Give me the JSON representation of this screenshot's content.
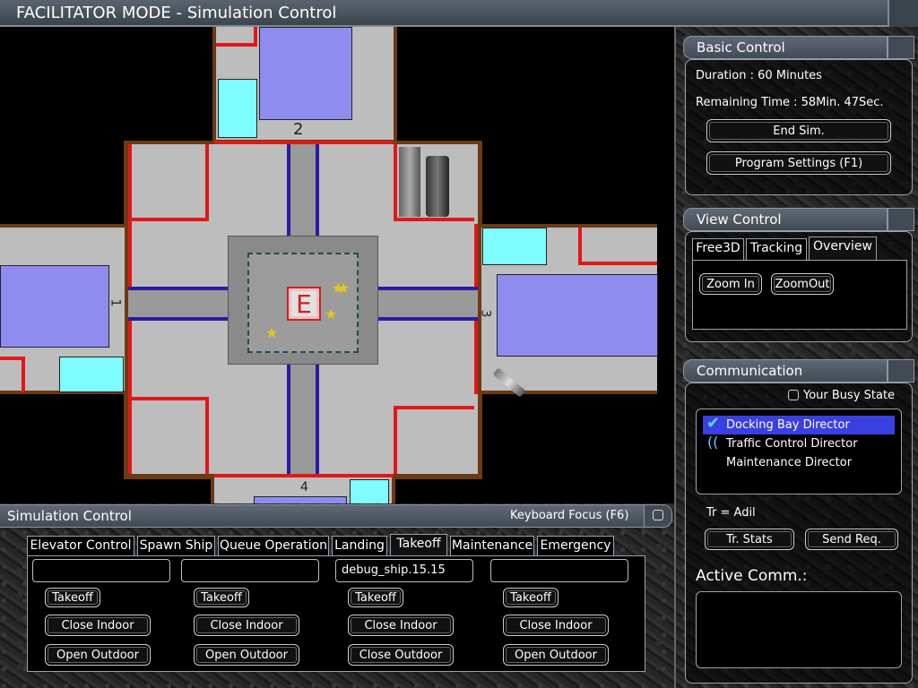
{
  "window": {
    "title": "FACILITATOR MODE - Simulation Control"
  },
  "map": {
    "elevator_label": "E",
    "bay_labels": [
      "2",
      "1",
      "3",
      "4"
    ]
  },
  "basic_control": {
    "title": "Basic Control",
    "duration": "Duration : 60 Minutes",
    "remaining": "Remaining Time : 58Min. 47Sec.",
    "end_sim": "End Sim.",
    "program_settings": "Program Settings (F1)"
  },
  "view_control": {
    "title": "View Control",
    "tabs": [
      "Free3D",
      "Tracking",
      "Overview"
    ],
    "zoom_in": "Zoom In",
    "zoom_out": "ZoomOut"
  },
  "communication": {
    "title": "Communication",
    "busy_state": "Your Busy State",
    "directors": [
      "Docking Bay Director",
      "Traffic Control Director",
      "Maintenance Director"
    ],
    "tr_line": "Tr = Adil",
    "tr_stats": "Tr. Stats",
    "send_req": "Send Req.",
    "active_comm": "Active Comm.:"
  },
  "sim_control": {
    "title": "Simulation Control",
    "keyboard_focus": "Keyboard Focus (F6)",
    "tabs": [
      "Elevator Control",
      "Spawn Ship",
      "Queue Operation",
      "Landing",
      "Takeoff",
      "Maintenance",
      "Emergency"
    ],
    "columns": [
      {
        "field": "",
        "takeoff": "Takeoff",
        "indoor": "Close Indoor",
        "outdoor": "Open Outdoor"
      },
      {
        "field": "",
        "takeoff": "Takeoff",
        "indoor": "Close Indoor",
        "outdoor": "Open Outdoor"
      },
      {
        "field": "debug_ship.15.15",
        "takeoff": "Takeoff",
        "indoor": "Close Indoor",
        "outdoor": "Close Outdoor"
      },
      {
        "field": "",
        "takeoff": "Takeoff",
        "indoor": "Close Indoor",
        "outdoor": "Open Outdoor"
      }
    ]
  },
  "colors": {
    "selection": "#3a3fe0",
    "check_icon": "#5fd2ff",
    "wall_red": "#e01818",
    "wall_brown": "#6b3a14",
    "pad_blue": "#8f8cf0",
    "pad_cyan": "#7ffcff"
  },
  "icons": [
    "checkmark-icon",
    "signal-icon",
    "checkbox-icon",
    "pointer-cursor-icon",
    "window-restore-icon"
  ]
}
